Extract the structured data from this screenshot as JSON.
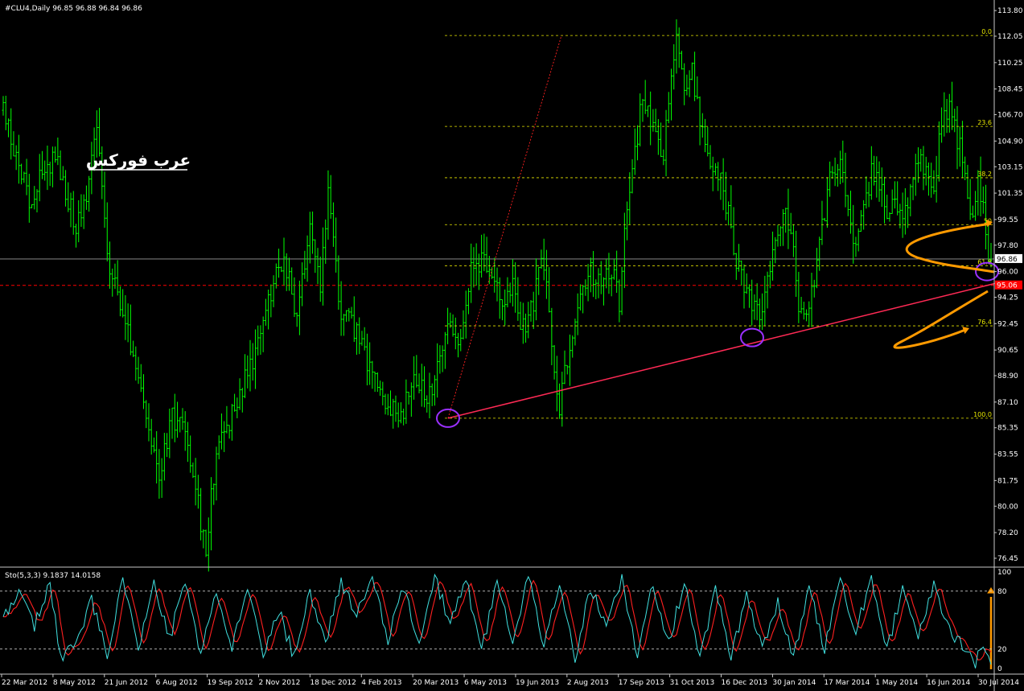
{
  "window": {
    "symbol_title": "#CLU4,Daily  96.85 96.88 96.84 96.86",
    "watermark": "عرب فوركس"
  },
  "colors": {
    "background": "#000000",
    "candles": "#00ff00",
    "fib_levels": "#e6e600",
    "trendline": "#ff2a55",
    "circle": "#9a30ff",
    "arrow": "#ff9a00",
    "sto_main": "#40e0e0",
    "sto_signal": "#ff2020",
    "bid_label": "#ff0000"
  },
  "chart_data": [
    {
      "type": "candlestick",
      "title": "#CLU4,Daily",
      "ohlc_last": {
        "open": 96.85,
        "high": 96.88,
        "low": 96.84,
        "close": 96.86
      },
      "x_ticks": [
        "22 Mar 2012",
        "8 May 2012",
        "21 Jun 2012",
        "6 Aug 2012",
        "19 Sep 2012",
        "2 Nov 2012",
        "18 Dec 2012",
        "4 Feb 2013",
        "20 Mar 2013",
        "6 May 2013",
        "19 Jun 2013",
        "2 Aug 2013",
        "17 Sep 2013",
        "31 Oct 2013",
        "16 Dec 2013",
        "30 Jan 2014",
        "17 Mar 2014",
        "1 May 2014",
        "16 Jun 2014",
        "30 Jul 2014"
      ],
      "y_ticks": [
        "113.80",
        "112.05",
        "110.25",
        "108.45",
        "106.70",
        "104.90",
        "103.15",
        "101.35",
        "99.55",
        "97.80",
        "96.00",
        "94.25",
        "92.45",
        "90.65",
        "88.90",
        "87.10",
        "85.35",
        "83.55",
        "81.75",
        "80.00",
        "78.20",
        "76.45"
      ],
      "ylim": [
        75.9,
        114.3
      ],
      "current_price": "96.86",
      "bid_line": "95.06",
      "close_anchors": [
        [
          0,
          107
        ],
        [
          10,
          101
        ],
        [
          20,
          104
        ],
        [
          28,
          99
        ],
        [
          33,
          102
        ],
        [
          36,
          106
        ],
        [
          40,
          97
        ],
        [
          45,
          94
        ],
        [
          50,
          90
        ],
        [
          55,
          86
        ],
        [
          60,
          82
        ],
        [
          65,
          86
        ],
        [
          70,
          85
        ],
        [
          75,
          80
        ],
        [
          78,
          77
        ],
        [
          82,
          84
        ],
        [
          90,
          87
        ],
        [
          96,
          90
        ],
        [
          102,
          94
        ],
        [
          108,
          97
        ],
        [
          113,
          93
        ],
        [
          118,
          99
        ],
        [
          122,
          95
        ],
        [
          125,
          101
        ],
        [
          130,
          93
        ],
        [
          136,
          92
        ],
        [
          142,
          89
        ],
        [
          148,
          87
        ],
        [
          153,
          86
        ],
        [
          158,
          89
        ],
        [
          163,
          87
        ],
        [
          168,
          90
        ],
        [
          172,
          93
        ],
        [
          176,
          91
        ],
        [
          180,
          96
        ],
        [
          184,
          97
        ],
        [
          188,
          96
        ],
        [
          192,
          93
        ],
        [
          196,
          95
        ],
        [
          200,
          92
        ],
        [
          204,
          94
        ],
        [
          207,
          97
        ],
        [
          210,
          94
        ],
        [
          212,
          89
        ],
        [
          214,
          87
        ],
        [
          218,
          91
        ],
        [
          222,
          95
        ],
        [
          226,
          96
        ],
        [
          230,
          95
        ],
        [
          234,
          96
        ],
        [
          237,
          94
        ],
        [
          240,
          101
        ],
        [
          243,
          104
        ],
        [
          246,
          108
        ],
        [
          250,
          106
        ],
        [
          254,
          104
        ],
        [
          257,
          109
        ],
        [
          259,
          112
        ],
        [
          262,
          108
        ],
        [
          265,
          110
        ],
        [
          268,
          106
        ],
        [
          272,
          103
        ],
        [
          276,
          102
        ],
        [
          280,
          99
        ],
        [
          282,
          97
        ],
        [
          285,
          95
        ],
        [
          288,
          94
        ],
        [
          291,
          93
        ],
        [
          294,
          96
        ],
        [
          298,
          98
        ],
        [
          301,
          100
        ],
        [
          304,
          97
        ],
        [
          306,
          94
        ],
        [
          308,
          93
        ],
        [
          312,
          95
        ],
        [
          315,
          99
        ],
        [
          318,
          102
        ],
        [
          322,
          103
        ],
        [
          325,
          100
        ],
        [
          328,
          98
        ],
        [
          331,
          100
        ],
        [
          334,
          103
        ],
        [
          337,
          102
        ],
        [
          340,
          100
        ],
        [
          343,
          101
        ],
        [
          346,
          99
        ],
        [
          349,
          102
        ],
        [
          352,
          104
        ],
        [
          355,
          103
        ],
        [
          358,
          102
        ],
        [
          361,
          106
        ],
        [
          364,
          107
        ],
        [
          367,
          105
        ],
        [
          370,
          103
        ],
        [
          373,
          99
        ],
        [
          375,
          102
        ],
        [
          377,
          100
        ],
        [
          379,
          97
        ],
        [
          380,
          96.86
        ]
      ],
      "fibonacci_levels": [
        {
          "label": "0.0",
          "price": 112.1
        },
        {
          "label": "23.6",
          "price": 105.9
        },
        {
          "label": "38.2",
          "price": 102.4
        },
        {
          "label": "50",
          "price": 99.2
        },
        {
          "label": "61.8",
          "price": 96.4
        },
        {
          "label": "76.4",
          "price": 92.3
        },
        {
          "label": "100.0",
          "price": 86.0
        }
      ]
    },
    {
      "type": "line",
      "title": "Sto(5,3,3) 9.1837 14.0158",
      "y_ticks": [
        "100",
        "80",
        "20",
        "0"
      ],
      "ylim": [
        -6,
        104
      ],
      "levels": [
        80,
        20
      ],
      "signal_lag": 1.5,
      "main_anchors": [
        [
          0,
          55
        ],
        [
          6,
          75
        ],
        [
          12,
          45
        ],
        [
          18,
          88
        ],
        [
          22,
          10
        ],
        [
          28,
          30
        ],
        [
          34,
          70
        ],
        [
          40,
          15
        ],
        [
          46,
          95
        ],
        [
          52,
          20
        ],
        [
          58,
          88
        ],
        [
          64,
          30
        ],
        [
          70,
          92
        ],
        [
          76,
          15
        ],
        [
          82,
          82
        ],
        [
          88,
          18
        ],
        [
          94,
          85
        ],
        [
          100,
          12
        ],
        [
          106,
          60
        ],
        [
          112,
          10
        ],
        [
          118,
          78
        ],
        [
          124,
          25
        ],
        [
          130,
          90
        ],
        [
          136,
          55
        ],
        [
          142,
          92
        ],
        [
          148,
          30
        ],
        [
          154,
          85
        ],
        [
          160,
          20
        ],
        [
          166,
          95
        ],
        [
          172,
          45
        ],
        [
          178,
          92
        ],
        [
          184,
          18
        ],
        [
          190,
          90
        ],
        [
          196,
          30
        ],
        [
          202,
          95
        ],
        [
          208,
          20
        ],
        [
          214,
          88
        ],
        [
          220,
          10
        ],
        [
          226,
          85
        ],
        [
          232,
          40
        ],
        [
          238,
          92
        ],
        [
          244,
          15
        ],
        [
          250,
          88
        ],
        [
          256,
          25
        ],
        [
          262,
          90
        ],
        [
          268,
          10
        ],
        [
          274,
          80
        ],
        [
          280,
          12
        ],
        [
          286,
          75
        ],
        [
          292,
          20
        ],
        [
          298,
          70
        ],
        [
          304,
          8
        ],
        [
          310,
          85
        ],
        [
          316,
          20
        ],
        [
          322,
          90
        ],
        [
          328,
          40
        ],
        [
          334,
          92
        ],
        [
          340,
          18
        ],
        [
          346,
          85
        ],
        [
          352,
          30
        ],
        [
          358,
          88
        ],
        [
          364,
          40
        ],
        [
          370,
          20
        ],
        [
          374,
          5
        ],
        [
          377,
          25
        ],
        [
          379,
          9
        ]
      ]
    }
  ]
}
